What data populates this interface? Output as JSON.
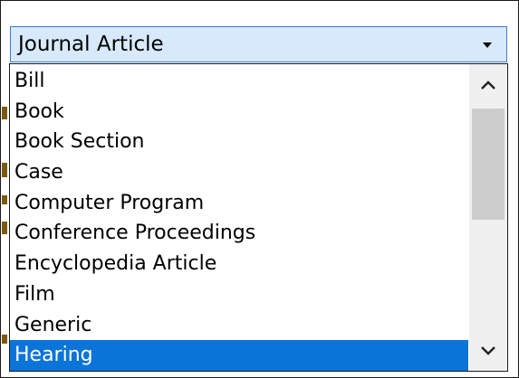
{
  "select": {
    "value": "Journal Article"
  },
  "options": [
    {
      "label": "Bill"
    },
    {
      "label": "Book"
    },
    {
      "label": "Book Section"
    },
    {
      "label": "Case"
    },
    {
      "label": "Computer Program"
    },
    {
      "label": "Conference Proceedings"
    },
    {
      "label": "Encyclopedia Article"
    },
    {
      "label": "Film"
    },
    {
      "label": "Generic"
    },
    {
      "label": "Hearing"
    }
  ],
  "highlighted_option": "Hearing",
  "icons": {
    "dropdown_arrow": "caret-down-icon",
    "scroll_up": "chevron-up-icon",
    "scroll_down": "chevron-down-icon"
  },
  "colors": {
    "select_background": "#d7e9fb",
    "select_border": "#3b7bd0",
    "highlight": "#0b74d9",
    "scrollbar_track": "#f0f0f0",
    "scrollbar_thumb": "#cdcdcd"
  }
}
